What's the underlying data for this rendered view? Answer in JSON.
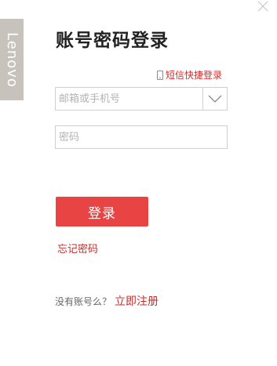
{
  "brand": {
    "name": "Lenovo"
  },
  "header": {
    "title": "账号密码登录"
  },
  "sms_login": {
    "label": "短信快捷登录",
    "icon": "phone-icon"
  },
  "account": {
    "placeholder": "邮箱或手机号"
  },
  "password": {
    "placeholder": "密码"
  },
  "login_button": {
    "label": "登录"
  },
  "forgot": {
    "label": "忘记密码"
  },
  "register": {
    "question": "没有账号么？",
    "link": "立即注册"
  },
  "colors": {
    "accent": "#e84444",
    "link": "#c13030",
    "brand_bg": "#c7c2bb"
  }
}
